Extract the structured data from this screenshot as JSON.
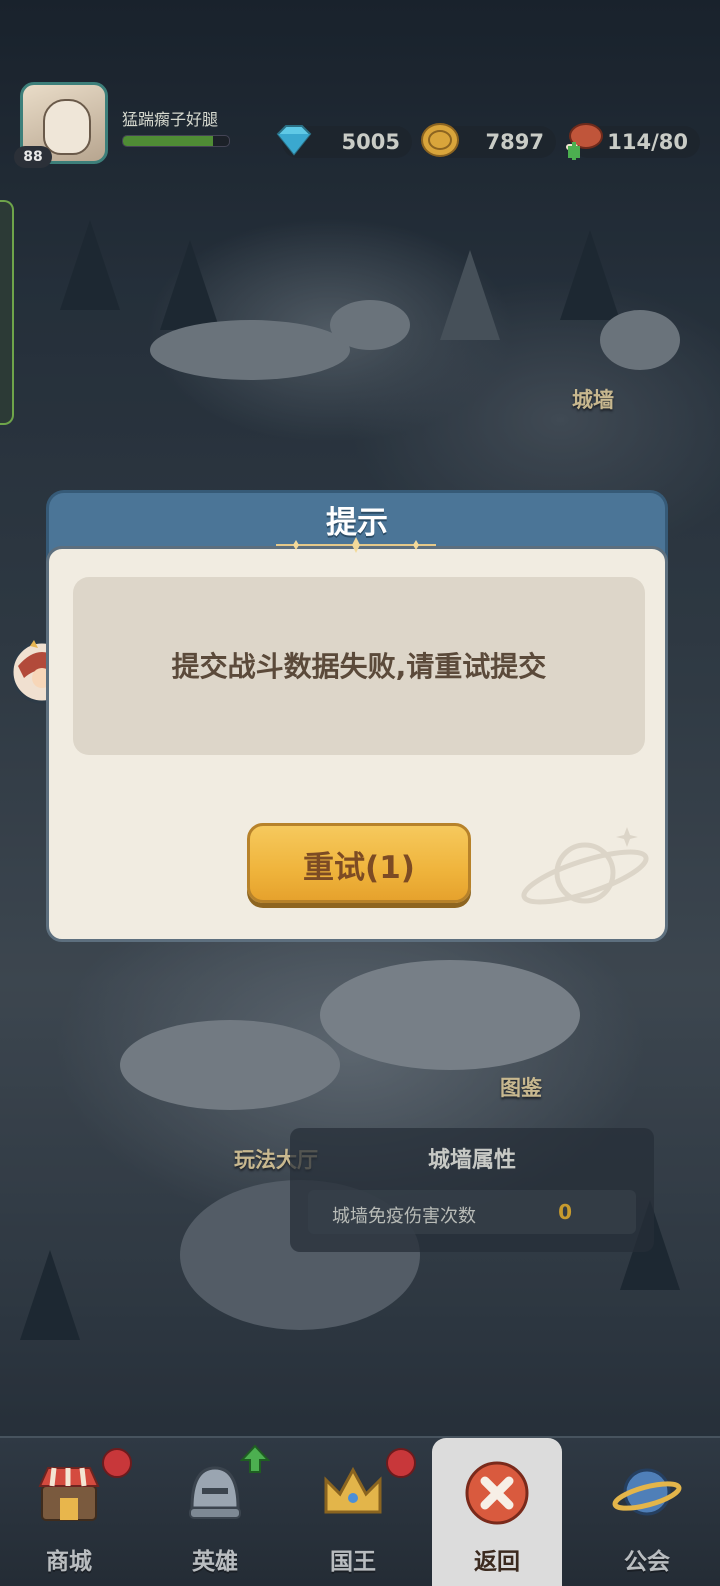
{
  "hud": {
    "player_name": "猛踹瘸子好腿",
    "level": "88",
    "exp_fraction": 0.85,
    "diamonds": "5005",
    "gold": "7897",
    "stamina": "114/80"
  },
  "map": {
    "label_wall": "城墙",
    "label_collection": "图鉴",
    "label_hall": "玩法大厅"
  },
  "wall_panel": {
    "title": "城墙属性",
    "row_label": "城墙免疫伤害次数",
    "row_value": "0"
  },
  "dialog": {
    "title": "提示",
    "message": "提交战斗数据失败,请重试提交",
    "retry_label": "重试(1)"
  },
  "nav": {
    "items": [
      {
        "label": "商城",
        "icon": "shop-icon"
      },
      {
        "label": "英雄",
        "icon": "helmet-icon"
      },
      {
        "label": "国王",
        "icon": "crown-icon"
      },
      {
        "label": "返回",
        "icon": "close-icon"
      },
      {
        "label": "公会",
        "icon": "planet-icon"
      }
    ]
  },
  "colors": {
    "dialog_header": "#4b7597",
    "dialog_body": "#f1ece1",
    "button": "#efb43c",
    "text_brown": "#5b4a3a"
  }
}
